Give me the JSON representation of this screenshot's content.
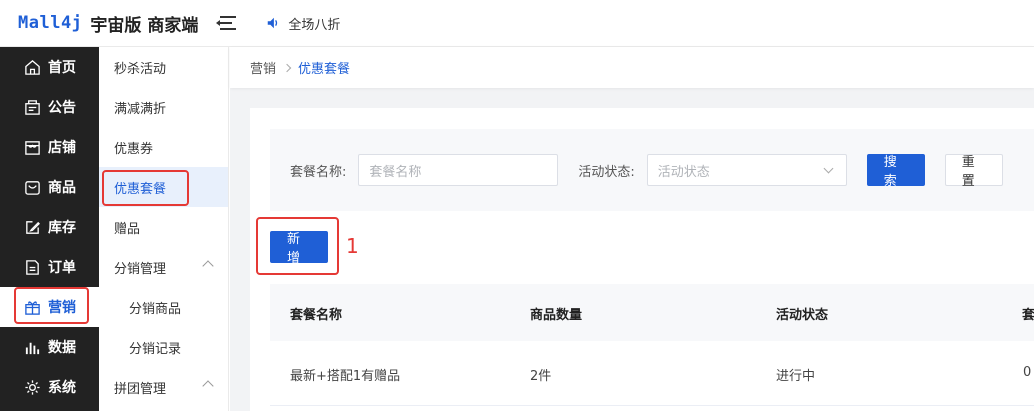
{
  "header": {
    "logo_mark": "Mall4j",
    "logo_text": "宇宙版 商家端",
    "notice": "全场八折"
  },
  "sidebar": {
    "items": [
      {
        "label": "首页",
        "icon": "home-icon"
      },
      {
        "label": "公告",
        "icon": "announcement-icon"
      },
      {
        "label": "店铺",
        "icon": "shop-icon"
      },
      {
        "label": "商品",
        "icon": "product-icon"
      },
      {
        "label": "库存",
        "icon": "edit-icon"
      },
      {
        "label": "订单",
        "icon": "order-icon"
      },
      {
        "label": "营销",
        "icon": "gift-icon",
        "active": true
      },
      {
        "label": "数据",
        "icon": "chart-icon"
      },
      {
        "label": "系统",
        "icon": "gear-icon"
      }
    ]
  },
  "submenu": {
    "items": [
      {
        "label": "秒杀活动"
      },
      {
        "label": "满减满折"
      },
      {
        "label": "优惠券"
      },
      {
        "label": "优惠套餐",
        "active": true
      },
      {
        "label": "赠品"
      },
      {
        "label": "分销管理",
        "expanded": true
      },
      {
        "label": "分销商品",
        "child": true
      },
      {
        "label": "分销记录",
        "child": true
      },
      {
        "label": "拼团管理",
        "expanded": true
      }
    ]
  },
  "breadcrumb": {
    "parent": "营销",
    "current": "优惠套餐"
  },
  "search": {
    "name_label": "套餐名称:",
    "name_placeholder": "套餐名称",
    "status_label": "活动状态:",
    "status_placeholder": "活动状态",
    "search_button": "搜索",
    "reset_button": "重置"
  },
  "actions": {
    "add_button": "新增",
    "step_number": "1"
  },
  "table": {
    "columns": [
      "套餐名称",
      "商品数量",
      "活动状态",
      "套"
    ],
    "rows": [
      [
        "最新+搭配1有赠品",
        "2件",
        "进行中",
        "0"
      ]
    ]
  },
  "colors": {
    "primary": "#1f5fd6",
    "highlight": "#e53935",
    "sidebar_bg": "#222222"
  }
}
